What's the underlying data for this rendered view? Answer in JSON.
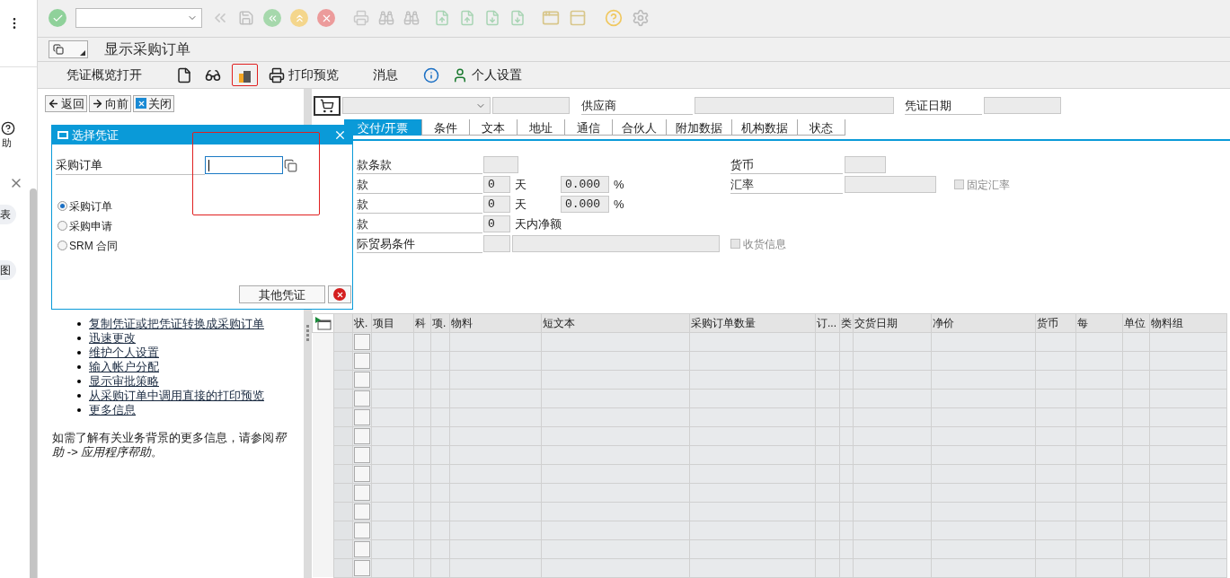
{
  "side_strip": {
    "help_label": "助",
    "chips": [
      "表",
      "图"
    ]
  },
  "title": "显示采购订单",
  "app_toolbar": {
    "overview": "凭证概览打开",
    "print_preview": "打印预览",
    "messages": "消息",
    "personal_settings": "个人设置"
  },
  "nav_buttons": [
    "返回",
    "向前",
    "关闭"
  ],
  "help_links": [
    "复制凭证或把凭证转换成采购订单",
    "迅速更改",
    "维护个人设置",
    "输入帐户分配",
    "显示审批策略",
    "从采购订单中调用直接的打印预览",
    "更多信息"
  ],
  "help_note": "如需了解有关业务背景的更多信息，请参阅",
  "help_note_link": "帮助 -> 应用程序帮助",
  "help_note_end": "。",
  "header": {
    "vendor_label": "供应商",
    "doc_date_label": "凭证日期"
  },
  "tabs": [
    {
      "label": "交付/开票",
      "selected": true
    },
    {
      "label": "条件",
      "selected": false
    },
    {
      "label": "文本",
      "selected": false
    },
    {
      "label": "地址",
      "selected": false
    },
    {
      "label": "通信",
      "selected": false
    },
    {
      "label": "合伙人",
      "selected": false
    },
    {
      "label": "附加数据",
      "selected": false
    },
    {
      "label": "机构数据",
      "selected": false
    },
    {
      "label": "状态",
      "selected": false
    }
  ],
  "form": {
    "rows": [
      {
        "kind": "code",
        "label": "款条款"
      },
      {
        "kind": "discount",
        "label": "款",
        "days": "0",
        "unit": "天",
        "percent": "0.000",
        "percent_sign": "%"
      },
      {
        "kind": "discount",
        "label": "款",
        "days": "0",
        "unit": "天",
        "percent": "0.000",
        "percent_sign": "%"
      },
      {
        "kind": "net",
        "label": "款",
        "days": "0",
        "unit": "天内净额"
      },
      {
        "kind": "incoterms",
        "label": "际贸易条件"
      }
    ],
    "currency_label": "货币",
    "rate_label": "汇率",
    "fixed_rate": {
      "label": "固定汇率",
      "checked": false,
      "disabled": true
    },
    "goods_receipt": {
      "label": "收货信息",
      "checked": false,
      "disabled": true
    }
  },
  "table": {
    "rows": [
      {
        "selected": false
      },
      {
        "selected": false
      },
      {
        "selected": false
      },
      {
        "selected": false
      },
      {
        "selected": false
      },
      {
        "selected": false
      },
      {
        "selected": false
      },
      {
        "selected": false
      },
      {
        "selected": false
      },
      {
        "selected": false
      },
      {
        "selected": false
      },
      {
        "selected": false
      },
      {
        "selected": false
      }
    ],
    "columns": [
      "状.",
      "项目",
      "科",
      "项.",
      "物料",
      "短文本",
      "采购订单数量",
      "订...",
      "类",
      "交货日期",
      "净价",
      "货币",
      "每",
      "单位",
      "物料组"
    ]
  },
  "dialog": {
    "title": "选择凭证",
    "field_label": "采购订单",
    "options": [
      {
        "label": "采购订单",
        "selected": true
      },
      {
        "label": "采购申请",
        "selected": false
      },
      {
        "label": "SRM 合同",
        "selected": false
      }
    ],
    "other_button": "其他凭证"
  }
}
